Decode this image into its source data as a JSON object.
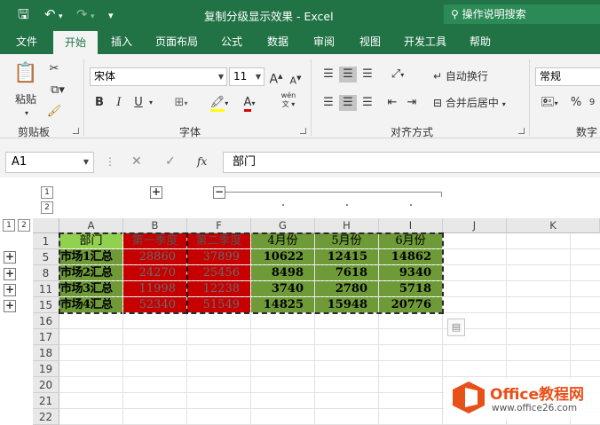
{
  "titlebar": {
    "title": "复制分级显示效果 - Excel",
    "tell_me": "操作说明搜索"
  },
  "tabs": [
    "文件",
    "开始",
    "插入",
    "页面布局",
    "公式",
    "数据",
    "审阅",
    "视图",
    "开发工具",
    "帮助"
  ],
  "active_tab": "开始",
  "ribbon": {
    "paste_label": "粘贴",
    "clipboard_group": "剪贴板",
    "font_name": "宋体",
    "font_size": "11",
    "font_group": "字体",
    "wrap_text": "自动换行",
    "merge_center": "合并后居中",
    "align_group": "对齐方式",
    "number_format": "常规",
    "number_group": "数字",
    "bold": "B",
    "italic": "I",
    "underline": "U",
    "grow_font": "A",
    "shrink_font": "A",
    "percent": "%",
    "wen": "wén",
    "fx": "fx"
  },
  "formula_bar": {
    "name_box": "A1",
    "content": "部门"
  },
  "outline": {
    "col_levels": [
      "1",
      "2"
    ],
    "row_levels": [
      "1",
      "2"
    ]
  },
  "sheet": {
    "columns": [
      "A",
      "B",
      "F",
      "G",
      "H",
      "I",
      "J",
      "K"
    ],
    "rows": [
      "1",
      "5",
      "8",
      "11",
      "15",
      "16",
      "17",
      "18",
      "19",
      "20",
      "21",
      "22"
    ],
    "header_row": [
      "部门",
      "第一季度",
      "第二季度",
      "4月份",
      "5月份",
      "6月份"
    ],
    "data_rows": [
      [
        "市场1汇总",
        "28860",
        "37899",
        "10622",
        "12415",
        "14862"
      ],
      [
        "市场2汇总",
        "24270",
        "25456",
        "8498",
        "7618",
        "9340"
      ],
      [
        "市场3汇总",
        "11998",
        "12238",
        "3740",
        "2780",
        "5718"
      ],
      [
        "市场4汇总",
        "52340",
        "51549",
        "14825",
        "15948",
        "20776"
      ]
    ]
  },
  "watermark": {
    "brand": "Office教程网",
    "url": "www.office26.com"
  },
  "colors": {
    "excel_green": "#217346",
    "cell_green": "#6e9a38",
    "cell_red": "#c60000",
    "cell_light_green": "#92d050"
  }
}
